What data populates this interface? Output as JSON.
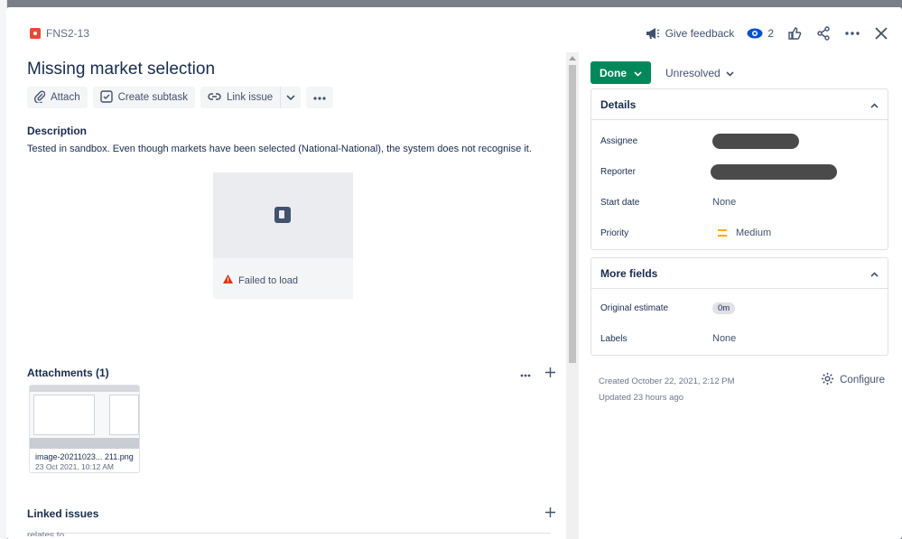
{
  "header": {
    "issue_key": "FNS2-13",
    "give_feedback_label": "Give feedback",
    "watchers_count": "2"
  },
  "issue": {
    "title": "Missing market selection",
    "actions": {
      "attach": "Attach",
      "create_subtask": "Create subtask",
      "link_issue": "Link issue"
    },
    "description": {
      "heading": "Description",
      "text": "Tested in sandbox. Even though markets have been selected (National-National), the system does not recognise it.",
      "embedded_image_error": "Failed to load"
    },
    "attachments": {
      "heading": "Attachments (1)",
      "items": [
        {
          "name": "image-20211023... 211.png",
          "date": "23 Oct 2021, 10:12 AM"
        }
      ]
    },
    "linked_issues": {
      "heading": "Linked issues",
      "relation": "relates to"
    }
  },
  "sidebar": {
    "status": "Done",
    "resolution": "Unresolved",
    "details": {
      "heading": "Details",
      "fields": [
        {
          "label": "Assignee",
          "value": ""
        },
        {
          "label": "Reporter",
          "value": ""
        },
        {
          "label": "Start date",
          "value": "None"
        },
        {
          "label": "Priority",
          "value": "Medium"
        }
      ]
    },
    "more_fields": {
      "heading": "More fields",
      "fields": [
        {
          "label": "Original estimate",
          "value": "0m"
        },
        {
          "label": "Labels",
          "value": "None"
        }
      ]
    },
    "created": "Created October 22, 2021, 2:12 PM",
    "updated": "Updated 23 hours ago",
    "configure_label": "Configure"
  },
  "colors": {
    "status_done": "#00875a",
    "bug_icon": "#e5493a",
    "priority_medium": "#ffab00"
  }
}
